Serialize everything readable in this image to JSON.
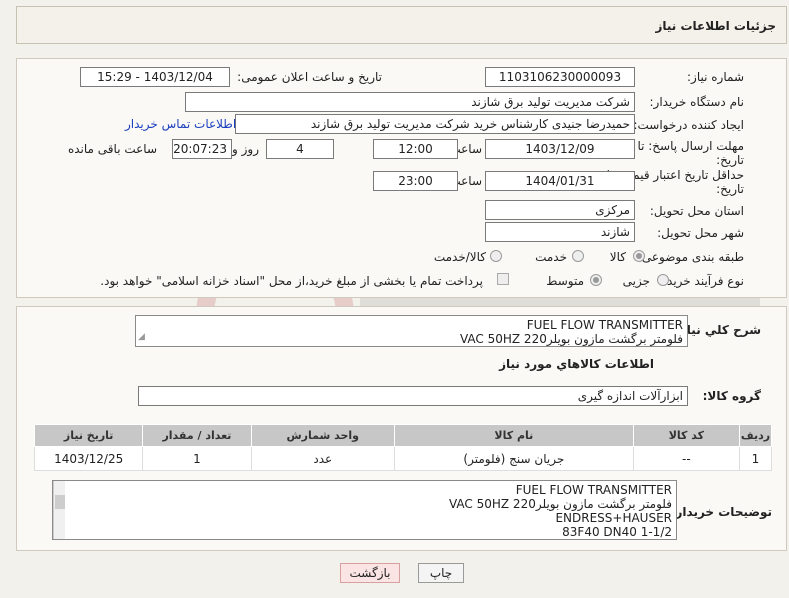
{
  "header": {
    "title": "جزئیات اطلاعات نیاز"
  },
  "fields": {
    "need_number_label": "شماره نیاز:",
    "need_number": "1103106230000093",
    "announce_label": "تاریخ و ساعت اعلان عمومی:",
    "announce_value": "1403/12/04 - 15:29",
    "buyer_org_label": "نام دستگاه خریدار:",
    "buyer_org": "شرکت مدیریت تولید برق شازند",
    "creator_label": "ایجاد کننده درخواست:",
    "creator": "حمیدرضا جنیدی کارشناس خرید شرکت مدیریت تولید برق شازند",
    "contact_link": "اطلاعات تماس خریدار",
    "deadline_label_1": "مهلت ارسال پاسخ: تا",
    "deadline_label_2": "تاریخ:",
    "deadline_date": "1403/12/09",
    "time_label": "ساعت",
    "deadline_time": "12:00",
    "days_value": "4",
    "days_label": "روز و",
    "remaining_time": "20:07:23",
    "remaining_label": "ساعت باقی مانده",
    "validity_label_1": "حداقل تاریخ اعتبار قیمت: تا",
    "validity_label_2": "تاریخ:",
    "validity_date": "1404/01/31",
    "validity_time": "23:00",
    "province_label": "استان محل تحویل:",
    "province": "مرکزی",
    "city_label": "شهر محل تحویل:",
    "city": "شازند",
    "category_label": "طبقه بندی موضوعی:",
    "category_options": [
      "کالا",
      "خدمت",
      "کالا/خدمت"
    ],
    "process_label": "نوع فرآیند خرید :",
    "process_options": [
      "جزیی",
      "متوسط"
    ],
    "payment_note": "پرداخت تمام یا بخشی از مبلغ خرید،از محل \"اسناد خزانه اسلامی\" خواهد بود."
  },
  "description": {
    "label": "شرح کلي نياز:",
    "lines": [
      "FUEL FLOW TRANSMITTER",
      "VAC 50HZ 220فلومتر برگشت مازون بویلر"
    ]
  },
  "goods_info_title": "اطلاعات کالاهاي مورد نياز",
  "goods_group": {
    "label": "گروه کالا:",
    "value": "ابزارآلات اندازه گیری"
  },
  "table": {
    "headers": [
      "ردیف",
      "کد کالا",
      "نام کالا",
      "واحد شمارش",
      "تعداد / مقدار",
      "تاریخ نیاز"
    ],
    "rows": [
      [
        "1",
        "--",
        "جریان سنج (فلومتر)",
        "عدد",
        "1",
        "1403/12/25"
      ]
    ]
  },
  "buyer_notes": {
    "label": "توضیحات خریدار:",
    "lines": [
      "FUEL FLOW TRANSMITTER",
      "VAC 50HZ 220فلومتر برگشت مازون بویلر",
      "ENDRESS+HAUSER",
      "83F40 DN40 1-1/2"
    ]
  },
  "buttons": {
    "print": "چاپ",
    "back": "بازگشت"
  },
  "colors": {
    "link": "#1a3fbf",
    "table_header": "#c7c7c7",
    "back_button": "#fbe4e4"
  }
}
